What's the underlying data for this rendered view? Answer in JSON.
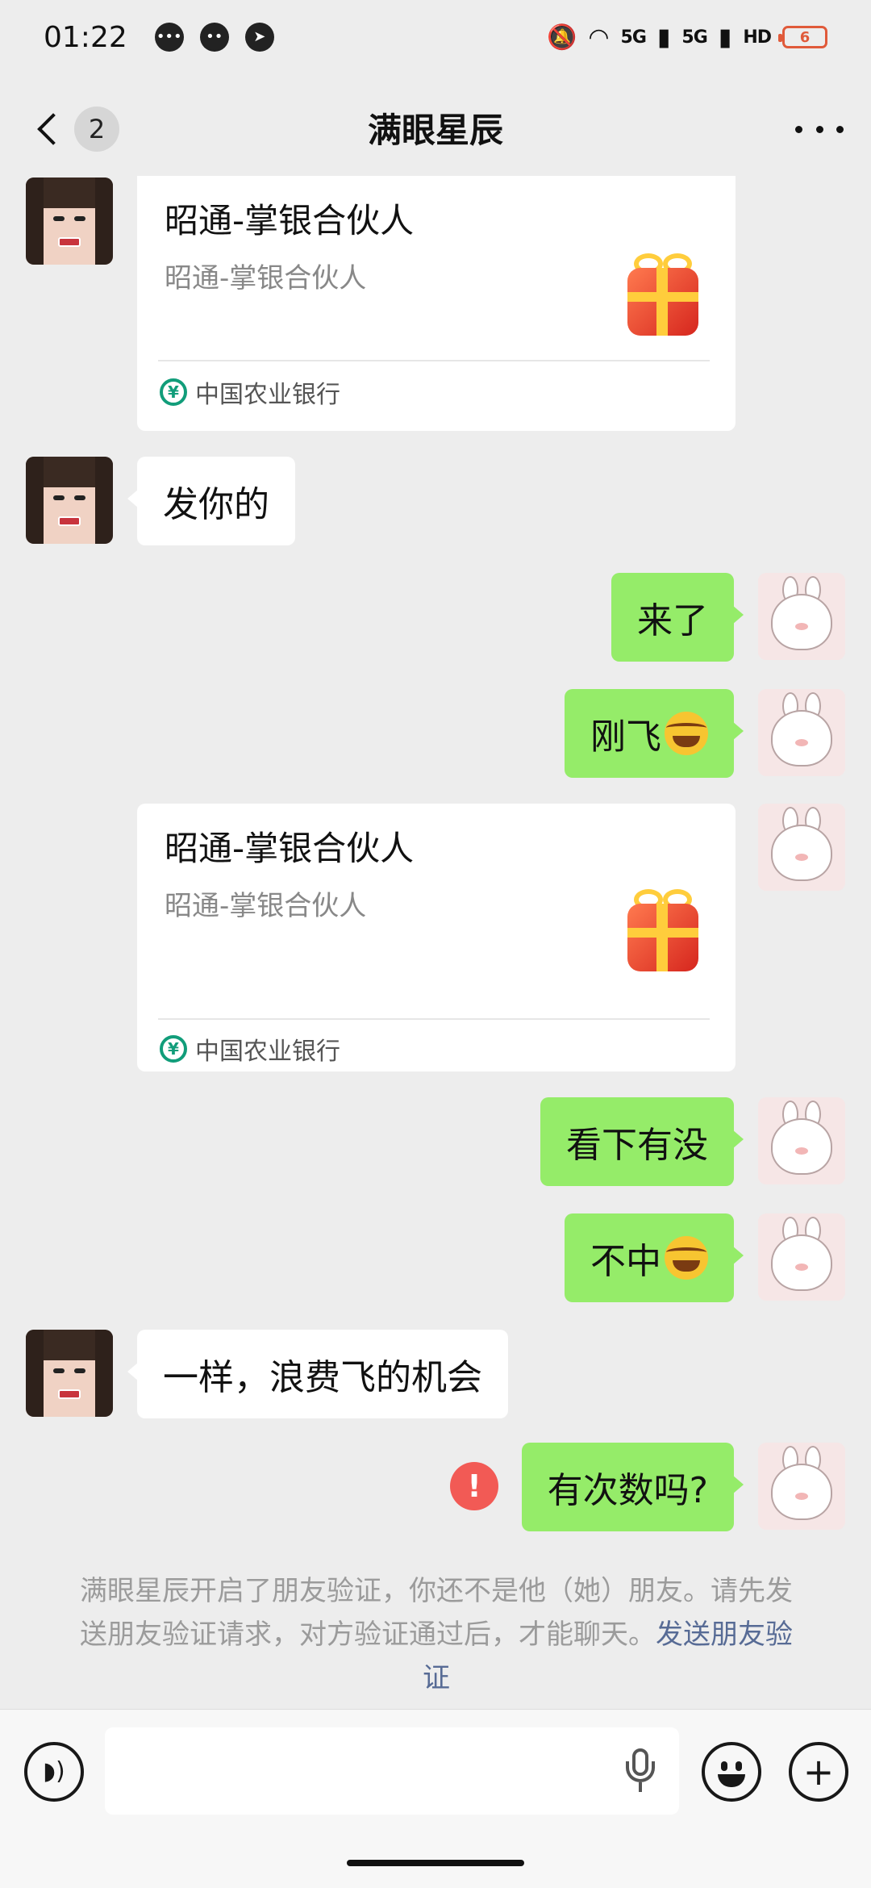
{
  "status_bar": {
    "time": "01:22",
    "left_icons": [
      "message-icon",
      "chat-icon",
      "send-icon"
    ],
    "network_1": "5G",
    "network_2": "5G",
    "hd": "HD",
    "battery": "6"
  },
  "header": {
    "back_count": "2",
    "title": "满眼星辰",
    "more_icon": "more-icon"
  },
  "messages": [
    {
      "side": "left",
      "type": "card",
      "title": "昭通-掌银合伙人",
      "subtitle": "昭通-掌银合伙人",
      "footer": "中国农业银行"
    },
    {
      "side": "left",
      "type": "text",
      "text": "发你的"
    },
    {
      "side": "right",
      "type": "text",
      "text": "来了"
    },
    {
      "side": "right",
      "type": "text",
      "text": "刚飞",
      "emoji": "laughing-tears-emoji"
    },
    {
      "side": "right",
      "type": "card",
      "title": "昭通-掌银合伙人",
      "subtitle": "昭通-掌银合伙人",
      "footer": "中国农业银行"
    },
    {
      "side": "right",
      "type": "text",
      "text": "看下有没"
    },
    {
      "side": "right",
      "type": "text",
      "text": "不中",
      "emoji": "laughing-tears-emoji"
    },
    {
      "side": "left",
      "type": "text",
      "text": "一样，浪费飞的机会"
    },
    {
      "side": "right",
      "type": "text",
      "text": "有次数吗?",
      "status": "failed",
      "status_mark": "!"
    }
  ],
  "notice": {
    "text": "满眼星辰开启了朋友验证，你还不是他（她）朋友。请先发送朋友验证请求，对方验证通过后，才能聊天。",
    "link": "发送朋友验证"
  },
  "input_bar": {
    "value": "",
    "voice_icon": "voice-icon",
    "mic_icon": "mic-icon",
    "emoji_icon": "emoji-icon",
    "plus_icon": "plus-icon"
  },
  "colors": {
    "background": "#ededed",
    "sent_bubble": "#95ec69",
    "received_bubble": "#ffffff",
    "error": "#f25a55",
    "link": "#576b95"
  }
}
